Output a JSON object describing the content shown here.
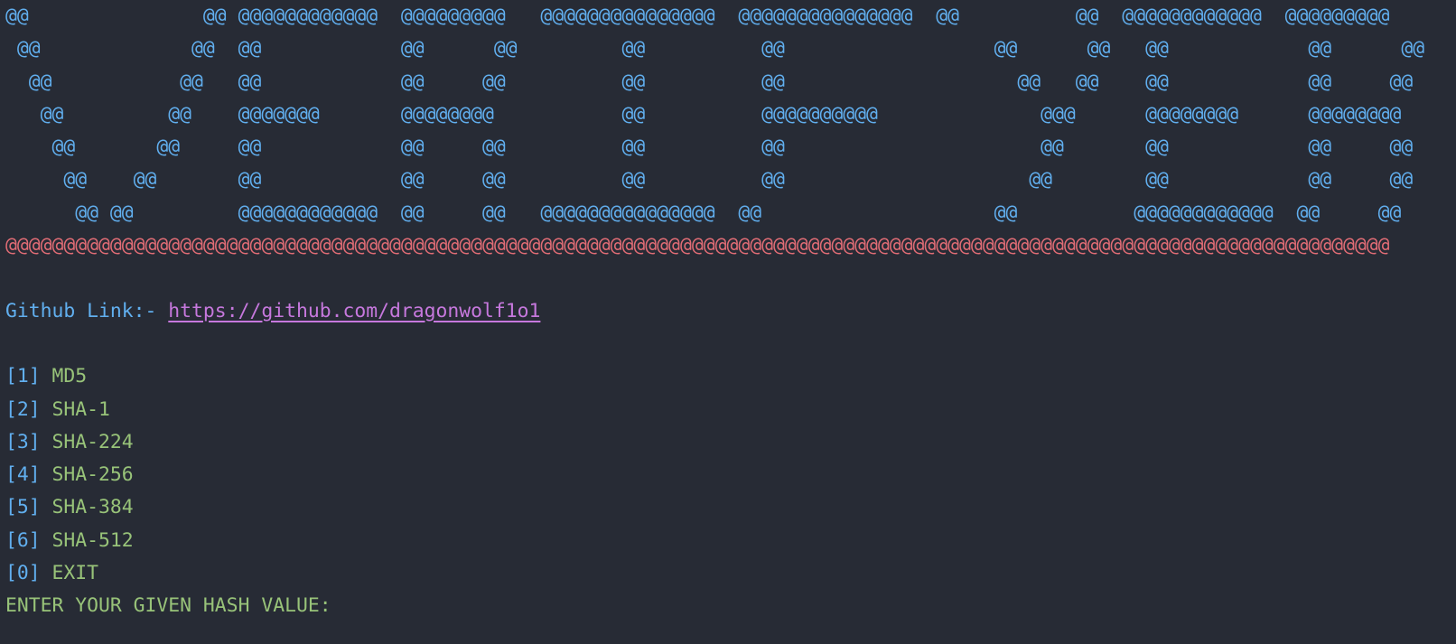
{
  "banner": {
    "lines": [
      "@@               @@ @@@@@@@@@@@@  @@@@@@@@@   @@@@@@@@@@@@@@@  @@@@@@@@@@@@@@@  @@          @@  @@@@@@@@@@@@  @@@@@@@@@",
      " @@             @@  @@            @@      @@         @@          @@                  @@      @@   @@            @@      @@",
      "  @@           @@   @@            @@     @@          @@          @@                    @@   @@    @@            @@     @@",
      "   @@         @@    @@@@@@@       @@@@@@@@           @@          @@@@@@@@@@              @@@      @@@@@@@@      @@@@@@@@",
      "    @@       @@     @@            @@     @@          @@          @@                      @@       @@            @@     @@",
      "     @@    @@       @@            @@     @@          @@          @@                     @@        @@            @@     @@",
      "      @@ @@         @@@@@@@@@@@@  @@     @@   @@@@@@@@@@@@@@@  @@                    @@          @@@@@@@@@@@@  @@     @@"
    ],
    "divider": "@@@@@@@@@@@@@@@@@@@@@@@@@@@@@@@@@@@@@@@@@@@@@@@@@@@@@@@@@@@@@@@@@@@@@@@@@@@@@@@@@@@@@@@@@@@@@@@@@@@@@@@@@@@@@@@@@@@@@@@"
  },
  "github": {
    "label": "Github Link:- ",
    "url": "https://github.com/dragonwolf1o1"
  },
  "menu": {
    "options": [
      {
        "index": "[1]",
        "name": "MD5"
      },
      {
        "index": "[2]",
        "name": "SHA-1"
      },
      {
        "index": "[3]",
        "name": "SHA-224"
      },
      {
        "index": "[4]",
        "name": "SHA-256"
      },
      {
        "index": "[5]",
        "name": "SHA-384"
      },
      {
        "index": "[6]",
        "name": "SHA-512"
      },
      {
        "index": "[0]",
        "name": "EXIT"
      }
    ]
  },
  "prompt": {
    "text": "ENTER YOUR GIVEN HASH VALUE:"
  },
  "colors": {
    "background": "#272b35",
    "banner": "#61afef",
    "divider": "#e06c75",
    "link": "#c678dd",
    "option": "#98c379"
  }
}
